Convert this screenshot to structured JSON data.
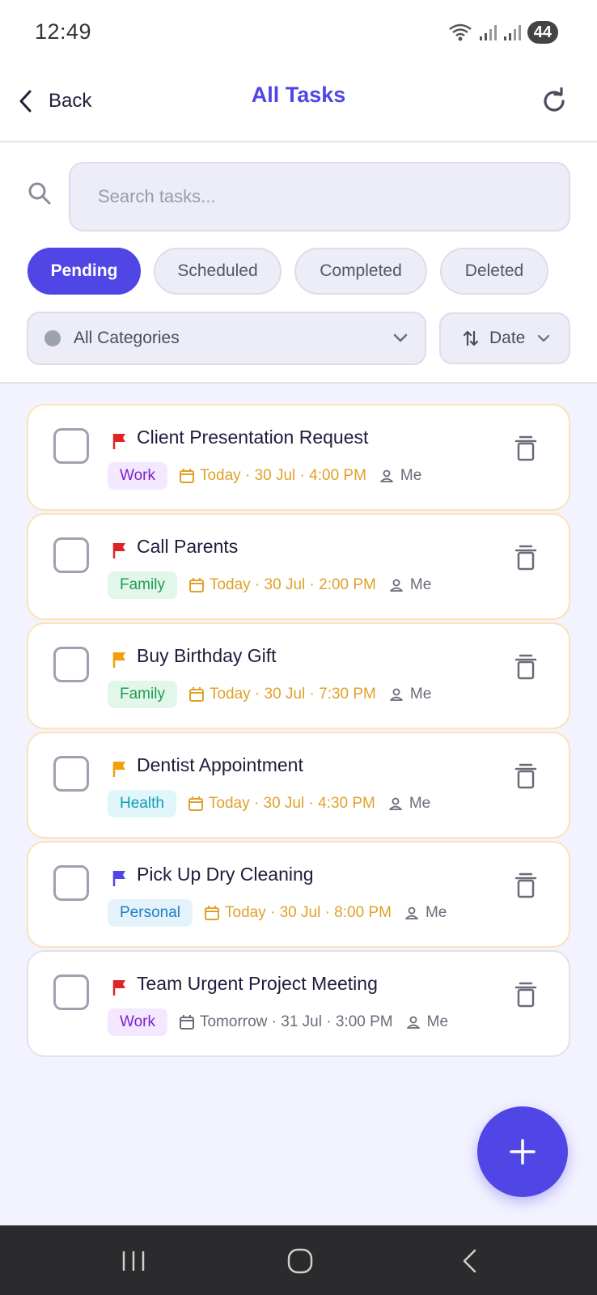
{
  "status_bar": {
    "time": "12:49",
    "battery": "44"
  },
  "header": {
    "back_label": "Back",
    "title": "All Tasks"
  },
  "search": {
    "placeholder": "Search tasks..."
  },
  "tabs": [
    {
      "label": "Pending",
      "active": true
    },
    {
      "label": "Scheduled",
      "active": false
    },
    {
      "label": "Completed",
      "active": false
    },
    {
      "label": "Deleted",
      "active": false
    }
  ],
  "category_filter": {
    "label": "All Categories"
  },
  "sort": {
    "label": "Date"
  },
  "colors": {
    "accent": "#4f46e5",
    "flag_high": "#dc2626",
    "flag_medium": "#f59e0b",
    "flag_low": "#4f46e5",
    "due_today": "#e0a12a"
  },
  "tasks": [
    {
      "title": "Client Presentation Request",
      "tag": "Work",
      "due": "Today · 30 Jul · 4:00 PM",
      "assignee": "Me",
      "priority": "high"
    },
    {
      "title": "Call Parents",
      "tag": "Family",
      "due": "Today · 30 Jul · 2:00 PM",
      "assignee": "Me",
      "priority": "high"
    },
    {
      "title": "Buy Birthday Gift",
      "tag": "Family",
      "due": "Today · 30 Jul · 7:30 PM",
      "assignee": "Me",
      "priority": "medium"
    },
    {
      "title": "Dentist Appointment",
      "tag": "Health",
      "due": "Today · 30 Jul · 4:30 PM",
      "assignee": "Me",
      "priority": "medium"
    },
    {
      "title": "Pick Up Dry Cleaning",
      "tag": "Personal",
      "due": "Today · 30 Jul · 8:00 PM",
      "assignee": "Me",
      "priority": "low"
    },
    {
      "title": "Team Urgent Project Meeting",
      "tag": "Work",
      "due": "Tomorrow · 31 Jul · 3:00 PM",
      "assignee": "Me",
      "priority": "high"
    }
  ],
  "icons": [
    "back-chevron-icon",
    "refresh-icon",
    "search-icon",
    "sort-icon",
    "chevron-down-icon",
    "flag-icon",
    "calendar-icon",
    "person-icon",
    "trash-icon",
    "plus-icon"
  ]
}
